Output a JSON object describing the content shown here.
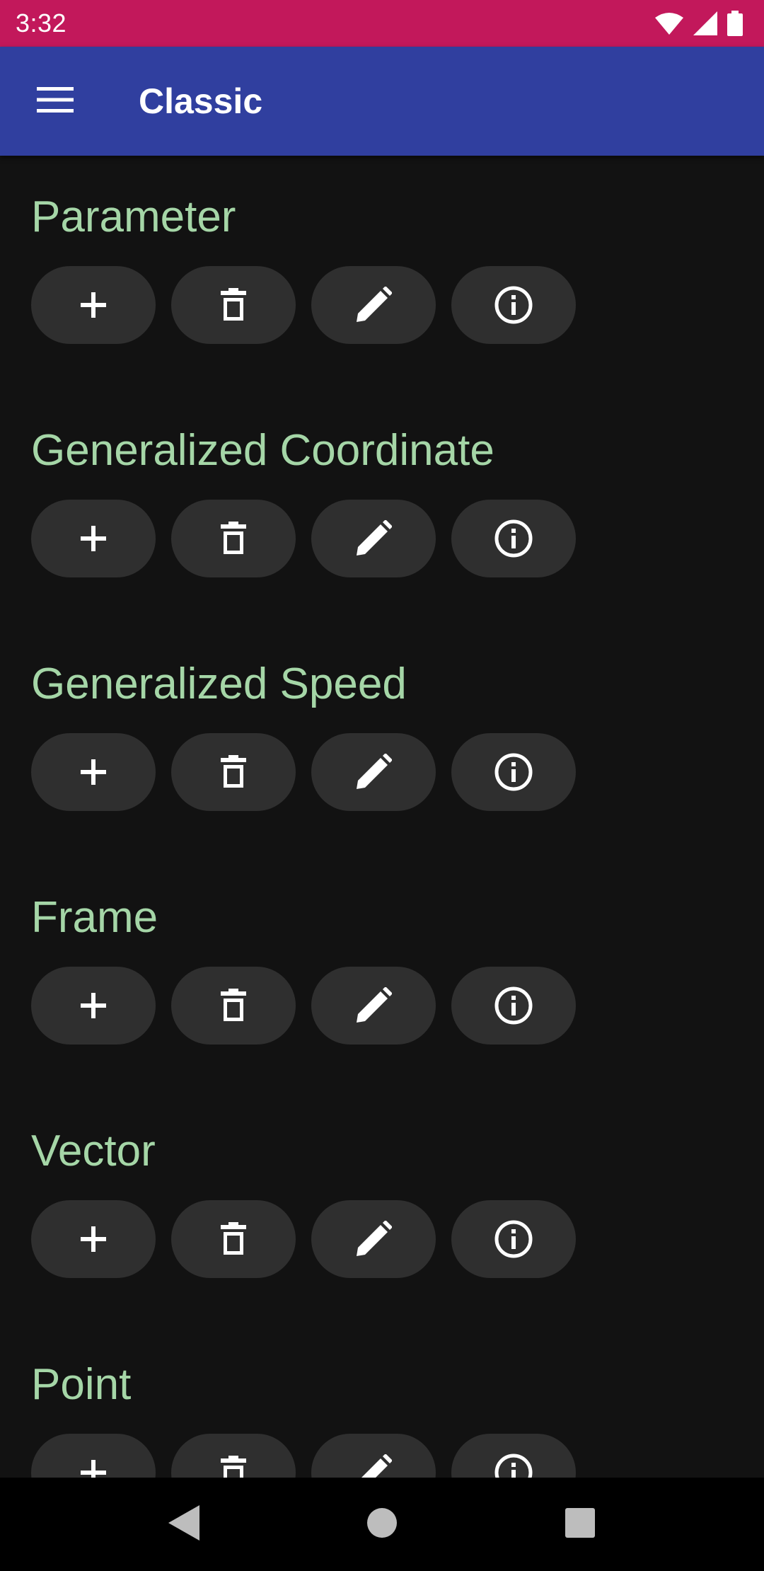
{
  "status_bar": {
    "time": "3:32",
    "icons": [
      "wifi-icon",
      "signal-icon",
      "battery-icon"
    ]
  },
  "app_bar": {
    "title": "Classic",
    "menu_icon": "hamburger-menu-icon"
  },
  "sections": [
    {
      "title": "Parameter"
    },
    {
      "title": "Generalized Coordinate"
    },
    {
      "title": "Generalized Speed"
    },
    {
      "title": "Frame"
    },
    {
      "title": "Vector"
    },
    {
      "title": "Point"
    }
  ],
  "section_buttons": [
    "add-icon",
    "delete-icon",
    "edit-icon",
    "info-icon"
  ],
  "nav_bar": {
    "buttons": [
      "back-icon",
      "home-icon",
      "recents-icon"
    ]
  },
  "colors": {
    "status_bar": "#c2185b",
    "app_bar": "#303f9f",
    "background": "#121212",
    "section_title": "#a5d6a7",
    "button_bg": "#2f2f2f",
    "icon": "#ffffff",
    "nav_icon": "#bdbdbd"
  }
}
